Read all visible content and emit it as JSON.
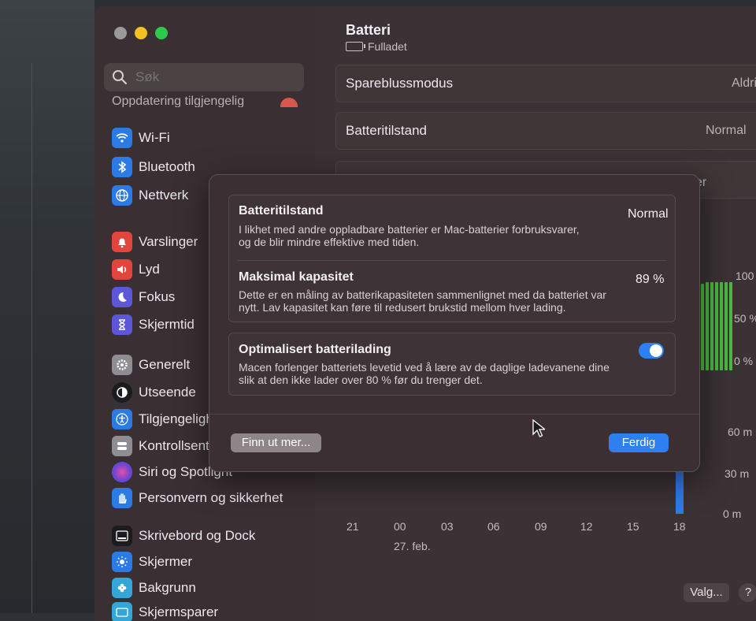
{
  "sidebar": {
    "search_placeholder": "Søk",
    "update_text": "Oppdatering tilgjengelig",
    "items": [
      {
        "label": "Wi-Fi",
        "icon": "wifi-icon",
        "color": "#2c7be5"
      },
      {
        "label": "Bluetooth",
        "icon": "bluetooth-icon",
        "color": "#2c7be5"
      },
      {
        "label": "Nettverk",
        "icon": "globe-icon",
        "color": "#2c7be5"
      },
      {
        "label": "Varslinger",
        "icon": "bell-icon",
        "color": "#e0463c"
      },
      {
        "label": "Lyd",
        "icon": "speaker-icon",
        "color": "#e0463c"
      },
      {
        "label": "Fokus",
        "icon": "moon-icon",
        "color": "#5b57d6"
      },
      {
        "label": "Skjermtid",
        "icon": "hourglass-icon",
        "color": "#5b57d6"
      },
      {
        "label": "Generelt",
        "icon": "gear-icon",
        "color": "#8d8d92"
      },
      {
        "label": "Utseende",
        "icon": "appearance-icon",
        "color": "#1c1c1e"
      },
      {
        "label": "Tilgjengelighet",
        "icon": "accessibility-icon",
        "color": "#2c7be5"
      },
      {
        "label": "Kontrollsenter",
        "icon": "control-center-icon",
        "color": "#8d8d92"
      },
      {
        "label": "Siri og Spotlight",
        "icon": "siri-icon",
        "color": "#7a4fd8"
      },
      {
        "label": "Personvern og sikkerhet",
        "icon": "hand-icon",
        "color": "#2c7be5"
      },
      {
        "label": "Skrivebord og Dock",
        "icon": "dock-icon",
        "color": "#1c1c1e"
      },
      {
        "label": "Skjermer",
        "icon": "sun-icon",
        "color": "#2c7be5"
      },
      {
        "label": "Bakgrunn",
        "icon": "flower-icon",
        "color": "#35a6d8"
      },
      {
        "label": "Skjermsparer",
        "icon": "screensaver-icon",
        "color": "#35a6d8"
      }
    ]
  },
  "main": {
    "title": "Batteri",
    "subtitle": "Fulladet",
    "rows": [
      {
        "label": "Spareblussmodus",
        "value": "Aldri"
      },
      {
        "label": "Batteritilstand",
        "value": "Normal"
      }
    ],
    "chart": {
      "y_labels_top": [
        "100",
        "50 %",
        "0 %"
      ],
      "y_labels_bottom": [
        "60 m",
        "30 m",
        "0 m"
      ],
      "x_labels": [
        "21",
        "00",
        "03",
        "06",
        "09",
        "12",
        "15",
        "18"
      ],
      "date_label": "27. feb.",
      "partial_top_label": "er",
      "bar_color": "#4ab93f",
      "usage_color": "#2f7be6"
    },
    "valg_label": "Valg...",
    "help_label": "?"
  },
  "dialog": {
    "health": {
      "title": "Batteritilstand",
      "value": "Normal",
      "desc_1": "I likhet med andre oppladbare batterier er Mac-batterier forbruksvarer,",
      "desc_2": "og de blir mindre effektive med tiden."
    },
    "capacity": {
      "title": "Maksimal kapasitet",
      "value": "89 %",
      "desc_1": "Dette er en måling av batterikapasiteten sammenlignet med da batteriet var",
      "desc_2": "nytt. Lav kapasitet kan føre til redusert brukstid mellom hver lading."
    },
    "optimized": {
      "title": "Optimalisert batterilading",
      "enabled": true,
      "desc_1": "Macen forlenger batteriets levetid ved å lære av de daglige ladevanene dine",
      "desc_2": "slik at den ikke lader over 80 % før du trenger det."
    },
    "learn_more_label": "Finn ut mer...",
    "done_label": "Ferdig"
  }
}
